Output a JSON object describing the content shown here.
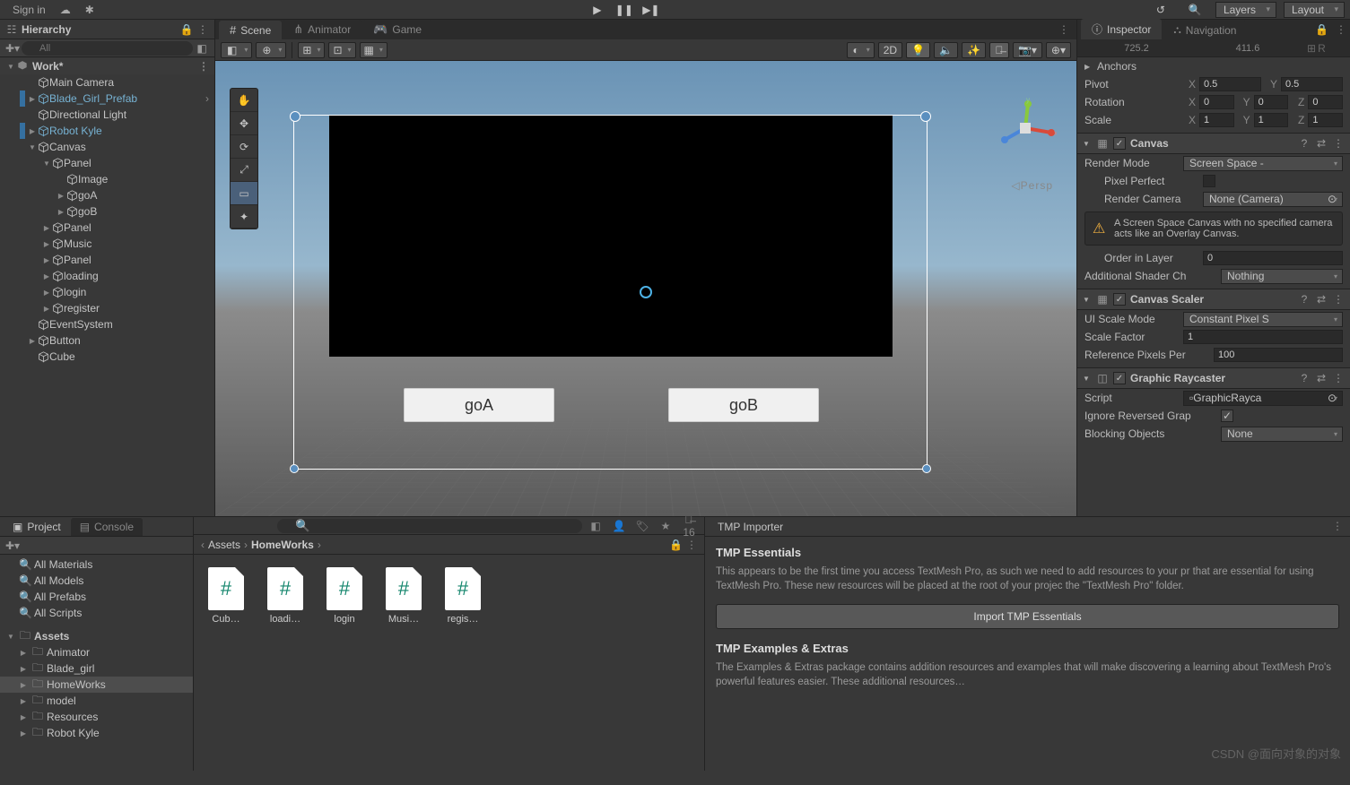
{
  "top": {
    "signin": "Sign in",
    "layers": "Layers",
    "layout": "Layout"
  },
  "hierarchy": {
    "title": "Hierarchy",
    "search_placeholder": "All",
    "scene": "Work*",
    "items": [
      {
        "name": "Main Camera",
        "d": 1,
        "prefab": false,
        "fold": ""
      },
      {
        "name": "Blade_Girl_Prefab",
        "d": 1,
        "prefab": true,
        "fold": "▶",
        "mod": true,
        "chev": true
      },
      {
        "name": "Directional Light",
        "d": 1,
        "prefab": false,
        "fold": ""
      },
      {
        "name": "Robot Kyle",
        "d": 1,
        "prefab": true,
        "fold": "▶",
        "mod": true
      },
      {
        "name": "Canvas",
        "d": 1,
        "prefab": false,
        "fold": "▼"
      },
      {
        "name": "Panel",
        "d": 2,
        "prefab": false,
        "fold": "▼"
      },
      {
        "name": "Image",
        "d": 3,
        "prefab": false,
        "fold": ""
      },
      {
        "name": "goA",
        "d": 3,
        "prefab": false,
        "fold": "▶"
      },
      {
        "name": "goB",
        "d": 3,
        "prefab": false,
        "fold": "▶"
      },
      {
        "name": "Panel",
        "d": 2,
        "prefab": false,
        "fold": "▶"
      },
      {
        "name": "Music",
        "d": 2,
        "prefab": false,
        "fold": "▶"
      },
      {
        "name": "Panel",
        "d": 2,
        "prefab": false,
        "fold": "▶"
      },
      {
        "name": "loading",
        "d": 2,
        "prefab": false,
        "fold": "▶"
      },
      {
        "name": "login",
        "d": 2,
        "prefab": false,
        "fold": "▶"
      },
      {
        "name": "register",
        "d": 2,
        "prefab": false,
        "fold": "▶"
      },
      {
        "name": "EventSystem",
        "d": 1,
        "prefab": false,
        "fold": ""
      },
      {
        "name": "Button",
        "d": 1,
        "prefab": false,
        "fold": "▶"
      },
      {
        "name": "Cube",
        "d": 1,
        "prefab": false,
        "fold": ""
      }
    ]
  },
  "sceneTabs": {
    "scene": "Scene",
    "animator": "Animator",
    "game": "Game"
  },
  "sceneToolbar": {
    "mode2d": "2D"
  },
  "sceneView": {
    "btnA": "goA",
    "btnB": "goB",
    "persp_label": "Persp",
    "gizmo_x": "x",
    "gizmo_y": "y",
    "gizmo_z": "z"
  },
  "inspector": {
    "tab_inspector": "Inspector",
    "tab_nav": "Navigation",
    "coord_x": "725.2",
    "coord_y": "411.6",
    "anchors": "Anchors",
    "pivot": "Pivot",
    "pivot_x": "0.5",
    "pivot_y": "0.5",
    "rotation": "Rotation",
    "rot_x": "0",
    "rot_y": "0",
    "rot_z": "0",
    "scale": "Scale",
    "scl_x": "1",
    "scl_y": "1",
    "scl_z": "1",
    "comp_canvas": "Canvas",
    "render_mode": "Render Mode",
    "render_mode_v": "Screen Space -",
    "pixel_perfect": "Pixel Perfect",
    "render_camera": "Render Camera",
    "render_camera_v": "None (Camera)",
    "warn": "A Screen Space Canvas with no specified camera acts like an Overlay Canvas.",
    "order_in_layer": "Order in Layer",
    "order_v": "0",
    "add_shader": "Additional Shader Ch",
    "add_shader_v": "Nothing",
    "comp_scaler": "Canvas Scaler",
    "ui_scale": "UI Scale Mode",
    "ui_scale_v": "Constant Pixel S",
    "scale_factor": "Scale Factor",
    "scale_factor_v": "1",
    "ref_px": "Reference Pixels Per",
    "ref_px_v": "100",
    "comp_ray": "Graphic Raycaster",
    "script": "Script",
    "script_v": "GraphicRayca",
    "ignore_rev": "Ignore Reversed Grap",
    "block_obj": "Blocking Objects",
    "block_obj_v": "None"
  },
  "project": {
    "tab_project": "Project",
    "tab_console": "Console",
    "filters": [
      "All Materials",
      "All Models",
      "All Prefabs",
      "All Scripts"
    ],
    "assets_label": "Assets",
    "folders": [
      "Animator",
      "Blade_girl",
      "HomeWorks",
      "model",
      "Resources",
      "Robot Kyle"
    ]
  },
  "assets": {
    "crumb1": "Assets",
    "crumb2": "HomeWorks",
    "hidden_count": "16",
    "files": [
      "Cub…",
      "loadi…",
      "login",
      "Musi…",
      "regis…"
    ]
  },
  "tmp": {
    "tab": "TMP Importer",
    "h1": "TMP Essentials",
    "p1": "This appears to be the first time you access TextMesh Pro, as such we need to add resources to your pr that are essential for using TextMesh Pro. These new resources will be placed at the root of your projec the \"TextMesh Pro\" folder.",
    "btn1": "Import TMP Essentials",
    "h2": "TMP Examples & Extras",
    "p2": "The Examples & Extras package contains addition resources and examples that will make discovering a learning about TextMesh Pro's powerful features easier. These additional resources…"
  },
  "watermark": "CSDN @面向对象的对象"
}
